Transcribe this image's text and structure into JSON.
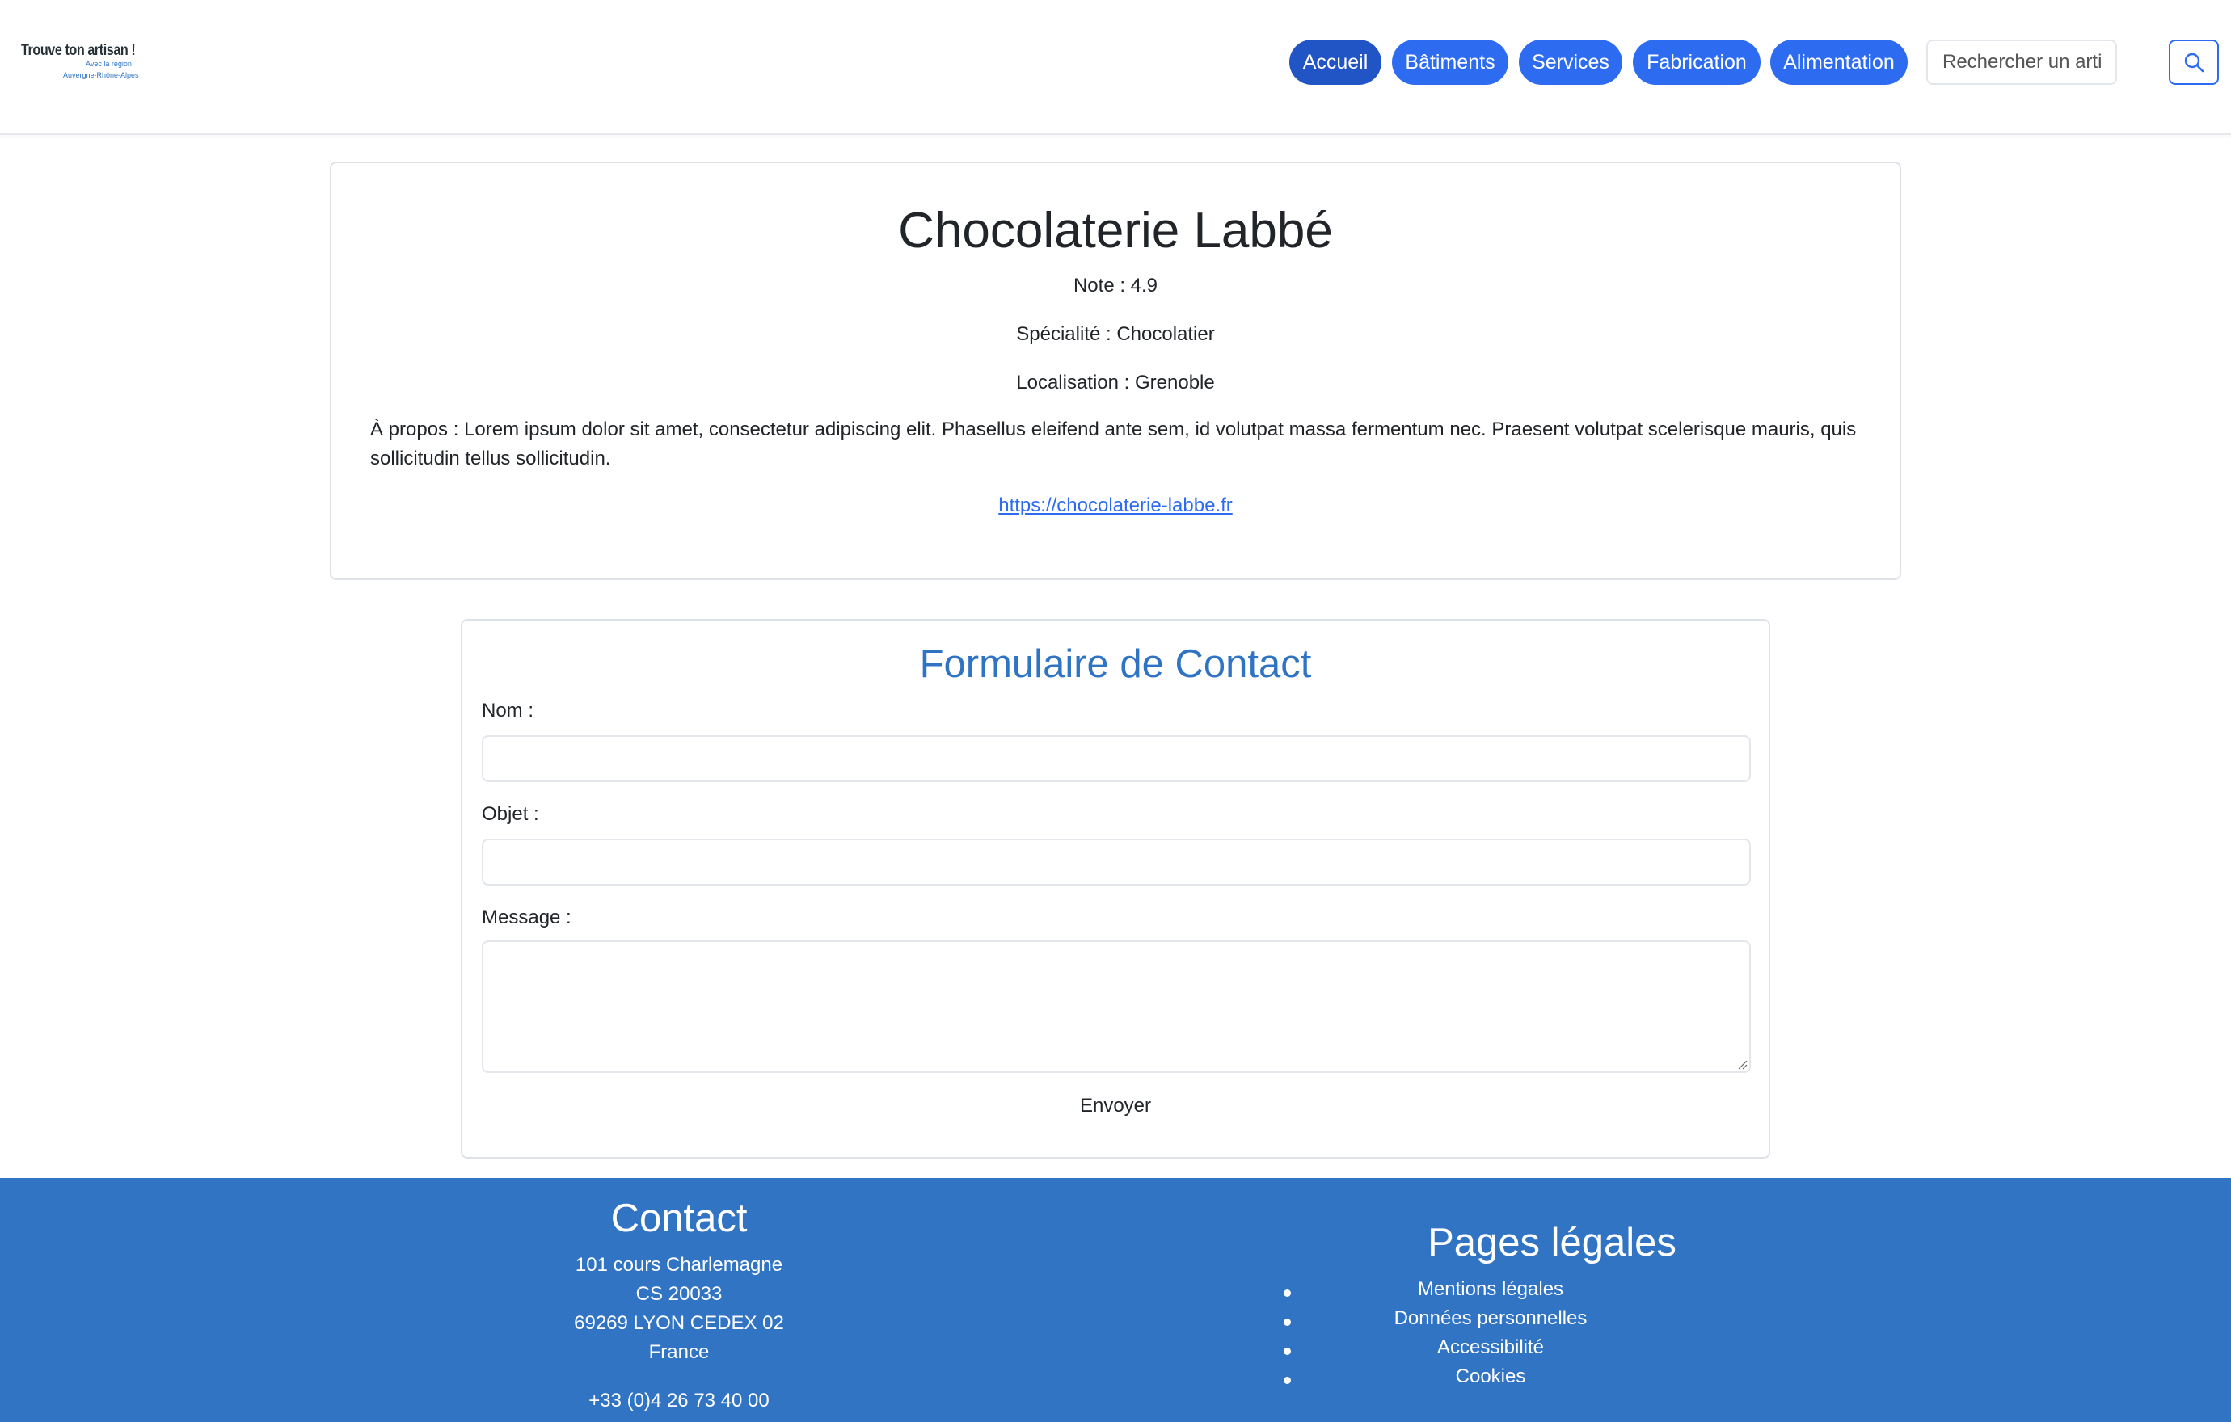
{
  "header": {
    "logo": {
      "line1": "Trouve ton artisan !",
      "line2": "Avec la région",
      "line3": "Auvergne-Rhône-Alpes"
    },
    "nav": [
      {
        "label": "Accueil",
        "active": true
      },
      {
        "label": "Bâtiments",
        "active": false
      },
      {
        "label": "Services",
        "active": false
      },
      {
        "label": "Fabrication",
        "active": false
      },
      {
        "label": "Alimentation",
        "active": false
      }
    ],
    "search": {
      "placeholder": "Rechercher un artisan",
      "icon": "search-icon"
    }
  },
  "profile": {
    "name": "Chocolaterie Labbé",
    "rating": "Note : 4.9",
    "specialty": "Spécialité : Chocolatier",
    "location": "Localisation : Grenoble",
    "about": "À propos : Lorem ipsum dolor sit amet, consectetur adipiscing elit. Phasellus eleifend ante sem, id volutpat massa fermentum nec. Praesent volutpat scelerisque mauris, quis sollicitudin tellus sollicitudin.",
    "website": "https://chocolaterie-labbe.fr"
  },
  "contact_form": {
    "title": "Formulaire de Contact",
    "name_label": "Nom :",
    "name_value": "",
    "subject_label": "Objet :",
    "subject_value": "",
    "message_label": "Message :",
    "message_value": "",
    "submit_label": "Envoyer"
  },
  "footer": {
    "contact": {
      "title": "Contact",
      "address": [
        "101 cours Charlemagne",
        "CS 20033",
        "69269 LYON CEDEX 02",
        "France"
      ],
      "phone": "+33 (0)4 26 73 40 00"
    },
    "legal": {
      "title": "Pages légales",
      "items": [
        "Mentions légales",
        "Données personnelles",
        "Accessibilité",
        "Cookies"
      ]
    }
  },
  "colors": {
    "nav_button": "#2d6cf0",
    "nav_button_active": "#2155c5",
    "form_title": "#2f74c4",
    "footer_bg": "#3174c4",
    "link": "#2d6cf0"
  }
}
